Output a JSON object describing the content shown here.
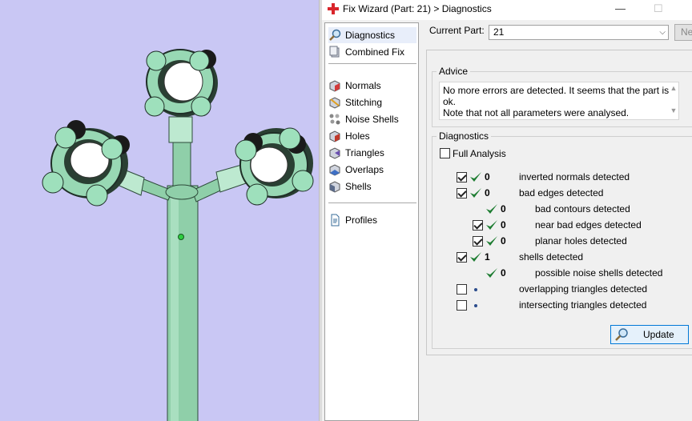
{
  "window": {
    "title": "Fix Wizard (Part: 21) > Diagnostics",
    "minimize_glyph": "—",
    "maximize_glyph": "☐"
  },
  "nav": {
    "items": [
      {
        "label": "Diagnostics",
        "icon": "magnifier-icon",
        "selected": true
      },
      {
        "label": "Combined Fix",
        "icon": "combined-fix-icon"
      },
      {
        "label": "Normals",
        "icon": "normals-cube-icon"
      },
      {
        "label": "Stitching",
        "icon": "stitching-cube-icon"
      },
      {
        "label": "Noise Shells",
        "icon": "noise-shells-icon"
      },
      {
        "label": "Holes",
        "icon": "holes-cube-icon"
      },
      {
        "label": "Triangles",
        "icon": "triangles-cube-icon"
      },
      {
        "label": "Overlaps",
        "icon": "overlaps-cube-icon"
      },
      {
        "label": "Shells",
        "icon": "shells-cube-icon"
      },
      {
        "label": "Profiles",
        "icon": "profiles-document-icon"
      }
    ]
  },
  "current_part": {
    "label": "Current Part:",
    "value": "21",
    "next_label": "Ne"
  },
  "advice": {
    "title": "Advice",
    "line1": "No more errors are detected. It seems that the part is ok.",
    "line2": "Note that not all parameters were analysed."
  },
  "diagnostics": {
    "title": "Diagnostics",
    "full_analysis_label": "Full Analysis",
    "full_analysis_checked": false,
    "rows": [
      {
        "checkbox": true,
        "checked": true,
        "indent": 0,
        "status": "ok",
        "count": "0",
        "label": "inverted normals detected"
      },
      {
        "checkbox": true,
        "checked": true,
        "indent": 0,
        "status": "ok",
        "count": "0",
        "label": "bad edges detected"
      },
      {
        "checkbox": false,
        "checked": false,
        "indent": 1,
        "status": "ok",
        "count": "0",
        "label": "bad contours detected"
      },
      {
        "checkbox": true,
        "checked": true,
        "indent": 1,
        "status": "ok",
        "count": "0",
        "label": "near bad edges detected"
      },
      {
        "checkbox": true,
        "checked": true,
        "indent": 1,
        "status": "ok",
        "count": "0",
        "label": "planar holes detected"
      },
      {
        "checkbox": true,
        "checked": true,
        "indent": 0,
        "status": "ok",
        "count": "1",
        "label": "shells detected"
      },
      {
        "checkbox": false,
        "checked": false,
        "indent": 1,
        "status": "ok",
        "count": "0",
        "label": "possible noise shells detected"
      },
      {
        "checkbox": true,
        "checked": false,
        "indent": 0,
        "status": "pending",
        "count": "",
        "label": "overlapping triangles detected"
      },
      {
        "checkbox": true,
        "checked": false,
        "indent": 0,
        "status": "pending",
        "count": "",
        "label": "intersecting triangles detected"
      }
    ],
    "update_label": "Update"
  },
  "colors": {
    "viewport_bg": "#c9c7f4",
    "part_green": "#98d8b4",
    "ok_tick": "#1e7d32",
    "accent": "#0078d7"
  }
}
